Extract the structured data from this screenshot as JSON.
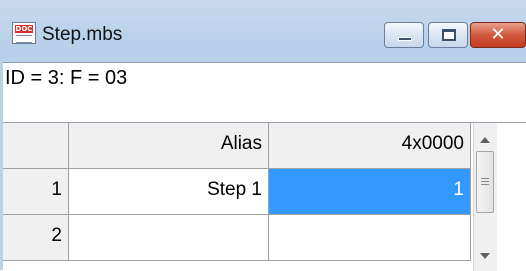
{
  "window": {
    "title": "Step.mbs",
    "app_icon": "document-icon",
    "app_icon_tag": "DOC",
    "controls": {
      "minimize": "minimize-icon",
      "maximize": "maximize-icon",
      "close": "close-icon"
    }
  },
  "id_line": "ID = 3: F = 03",
  "grid": {
    "columns": [
      "Alias",
      "4x0000"
    ],
    "rows": [
      {
        "num": "1",
        "alias": "Step 1",
        "value": "1"
      },
      {
        "num": "2",
        "alias": "",
        "value": ""
      }
    ],
    "selected_color": "#3399ff"
  }
}
